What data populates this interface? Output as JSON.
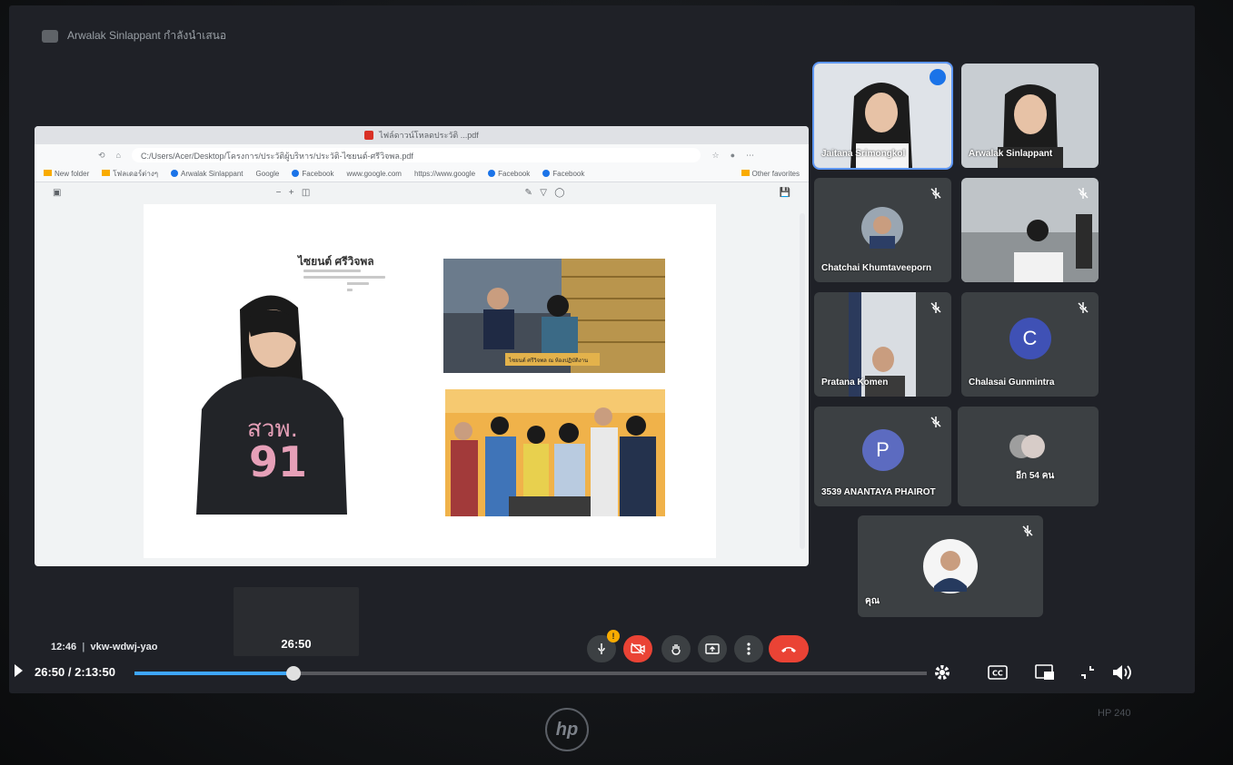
{
  "meet": {
    "presenter_label": "Arwalak Sinlappant กำลังนำเสนอ",
    "meeting_time": "12:46",
    "meeting_code": "vkw-wdwj-yao"
  },
  "browser": {
    "tab_title": "ไฟล์ดาวน์โหลดประวัติ ...pdf",
    "url": "C:/Users/Acer/Desktop/โครงการ/ประวัติผู้บริหาร/ประวัติ-ไซยนต์-ศรีวิจพล.pdf",
    "bookmarks": [
      "New folder",
      "โฟลเดอร์ต่างๆ",
      "Arwalak Sinlappant",
      "Google",
      "Facebook",
      "www.google.com",
      "https://www.google",
      "Facebook",
      "Facebook",
      "Other favorites"
    ]
  },
  "document": {
    "person_name": "ไซยนต์ ศรีวิจพล",
    "shirt_text_line1": "สวพ.",
    "shirt_text_line2": "91",
    "photo1_caption": "ไซยนต์ ศรีวิจพล ณ ห้องปฏิบัติงาน"
  },
  "participants": [
    {
      "name": "Jaitana Srimongkol",
      "active": true
    },
    {
      "name": "Arwalak Sinlappant"
    },
    {
      "name": "Chatchai Khumtaveeporn"
    },
    {
      "name": ""
    },
    {
      "name": "Pratana Komen"
    },
    {
      "name": "Chalasai Gunmintra",
      "initial": "C",
      "color": "#3f51b5"
    },
    {
      "name": "3539 ANANTAYA PHAIROT",
      "initial": "P",
      "color": "#5c6bc0"
    },
    {
      "name": "อีก 54 คน"
    },
    {
      "name": "คุณ"
    }
  ],
  "player": {
    "thumbnail_time": "26:50",
    "current_time": "26:50",
    "duration": "2:13:50",
    "progress": 0.2005
  },
  "monitor": {
    "brand": "hp",
    "model": "HP 240"
  }
}
